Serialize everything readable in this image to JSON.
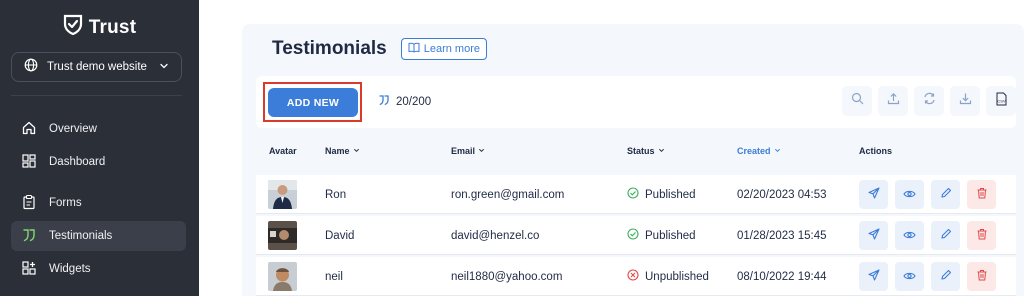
{
  "brand": {
    "name": "Trust"
  },
  "site_selector": {
    "label": "Trust demo website"
  },
  "nav": [
    {
      "label": "Overview",
      "icon": "home-icon"
    },
    {
      "label": "Dashboard",
      "icon": "dashboard-icon"
    },
    {
      "label": "Forms",
      "icon": "clipboard-icon"
    },
    {
      "label": "Testimonials",
      "icon": "quote-icon",
      "active": true
    },
    {
      "label": "Widgets",
      "icon": "widgets-icon"
    }
  ],
  "header": {
    "title": "Testimonials",
    "learn_more": "Learn more"
  },
  "toolbar": {
    "add_new": "ADD NEW",
    "quota": "20/200",
    "icons": [
      "search-icon",
      "upload-icon",
      "refresh-icon",
      "download-icon",
      "csv-icon"
    ]
  },
  "table": {
    "columns": [
      {
        "label": "Avatar",
        "sortable": false
      },
      {
        "label": "Name",
        "sortable": true
      },
      {
        "label": "Email",
        "sortable": true
      },
      {
        "label": "Status",
        "sortable": true
      },
      {
        "label": "Created",
        "sortable": true,
        "active": true
      },
      {
        "label": "Actions",
        "sortable": false
      }
    ],
    "rows": [
      {
        "name": "Ron",
        "email": "ron.green@gmail.com",
        "status": "Published",
        "created": "02/20/2023 04:53"
      },
      {
        "name": "David",
        "email": "david@henzel.co",
        "status": "Published",
        "created": "01/28/2023 15:45"
      },
      {
        "name": "neil",
        "email": "neil1880@yahoo.com",
        "status": "Unpublished",
        "created": "08/10/2022 19:44"
      }
    ]
  },
  "colors": {
    "accent": "#3b7dd8",
    "sidebar": "#2b2f38",
    "published": "#3cae5c",
    "unpublished": "#e04a4a",
    "highlight": "#d93a2b"
  }
}
